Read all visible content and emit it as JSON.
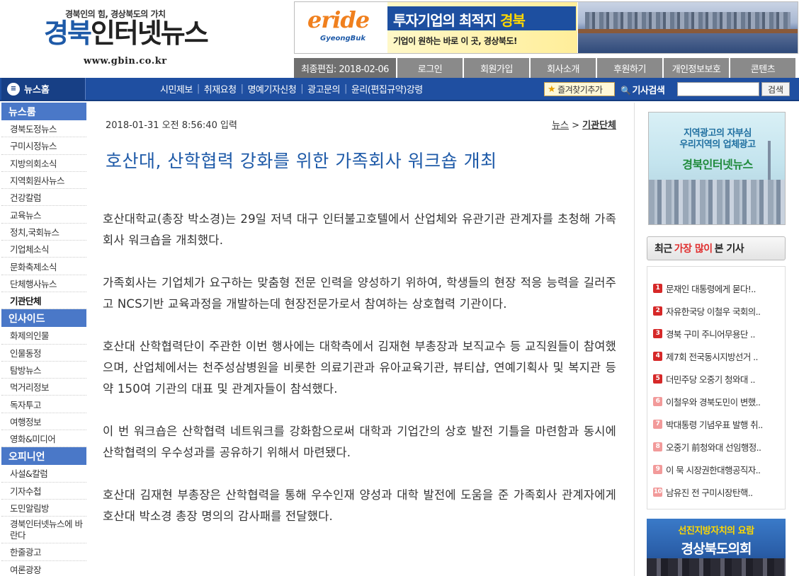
{
  "site": {
    "tagline": "경북인의 힘, 경상북도의 가치",
    "title_part1": "경북",
    "title_part2": "인터넷뉴스",
    "url": "www.gbin.co.kr"
  },
  "banner": {
    "brand": "eride",
    "brand_sub": "GyeongBuk",
    "headline_part1": "투자기업",
    "headline_part2": "의 최적지 ",
    "headline_part3": "경북",
    "subline": "기업이 원하는 바로 이 곳, 경상북도!"
  },
  "topbar": {
    "last_edit": "최종편집: 2018-02-06",
    "items": [
      "로그인",
      "회원가입",
      "회사소개",
      "후원하기",
      "개인정보보호",
      "콘텐츠"
    ]
  },
  "nav": {
    "home": "뉴스홈",
    "links": [
      "시민제보",
      "취재요청",
      "명예기자신청",
      "광고문의",
      "윤리(편집규약)강령"
    ],
    "favorite": "즐겨찾기추가",
    "search_label": "기사검색",
    "search_button": "검색"
  },
  "sidebar": {
    "sections": [
      {
        "title": "뉴스룸",
        "items": [
          "경북도정뉴스",
          "구미시정뉴스",
          "지방의회소식",
          "지역회원사뉴스",
          "건강칼럼",
          "교육뉴스",
          "정치,국회뉴스",
          "기업체소식",
          "문화축제소식",
          "단체행사뉴스",
          "기관단체"
        ]
      },
      {
        "title": "인사이드",
        "items": [
          "화제의인물",
          "인물동정",
          "탐방뉴스",
          "먹거리정보",
          "독자투고",
          "여행정보",
          "영화&미디어"
        ]
      },
      {
        "title": "오피니언",
        "items": [
          "사설&칼럼",
          "기자수첩",
          "도민알림방",
          "경북인터넷뉴스에 바란다",
          "한줄광고",
          "여론광장"
        ]
      }
    ]
  },
  "article": {
    "date": "2018-01-31 오전 8:56:40 입력",
    "breadcrumb": [
      "뉴스",
      "기관단체"
    ],
    "headline": "호산대, 산학협력 강화를 위한 가족회사 워크숍 개최",
    "paragraphs": [
      "호산대학교(총장 박소경)는 29일 저녁 대구 인터불고호텔에서 산업체와 유관기관 관계자를 초청해 가족회사 워크숍을 개최했다.",
      "가족회사는 기업체가 요구하는 맞춤형 전문 인력을 양성하기 위하여, 학생들의 현장 적응 능력을 길러주고 NCS기반 교육과정을 개발하는데 현장전문가로서 참여하는 상호협력 기관이다.",
      "호산대 산학협력단이 주관한 이번 행사에는 대학측에서 김재현 부총장과 보직교수 등 교직원들이 참여했으며, 산업체에서는 천주성삼병원을 비롯한 의료기관과 유아교육기관, 뷰티샵, 연예기획사 및 복지관 등 약 150여 기관의 대표 및 관계자들이 참석했다.",
      "이 번 워크숍은 산학협력 네트워크를 강화함으로써 대학과 기업간의 상호 발전 기틀을 마련함과 동시에 산학협력의 우수성과를 공유하기 위해서 마련됐다.",
      "호산대 김재현 부총장은 산학협력을 통해 우수인재 양성과 대학 발전에 도움을 준 가족회사 관계자에게 호산대 박소경 총장 명의의 감사패를 전달했다."
    ]
  },
  "right": {
    "ad1": {
      "line1": "지역광고의 자부심",
      "line2": "우리지역의 업체광고",
      "line3": "경북인터넷뉴스"
    },
    "popular": {
      "title_pre": "최근",
      "title_hl": "가장 많이",
      "title_post": "본 기사",
      "items": [
        "문재인 대통령에게 묻다!..",
        "자유한국당 이철우 국회의..",
        "경북 구미 주니어무용단 ..",
        "제7회 전국동시지방선거 ..",
        "더민주당 오중기 청와대 ..",
        "이철우와 경북도민이 변했..",
        "박대통령 기념우표 발행 취..",
        "오중기 前청와대 선임행정..",
        "이 묵 시장권한대행공직자..",
        "남유진 전 구미시장탄핵.."
      ]
    },
    "ad2": {
      "line1": "선진지방자치의 요람",
      "line2": "경상북도의회"
    }
  },
  "colors": {
    "brand_blue": "#1e5aa8",
    "nav_blue": "#1f4fa1",
    "sidebar_head": "#4a78c8",
    "rank_red": "#d62828"
  }
}
